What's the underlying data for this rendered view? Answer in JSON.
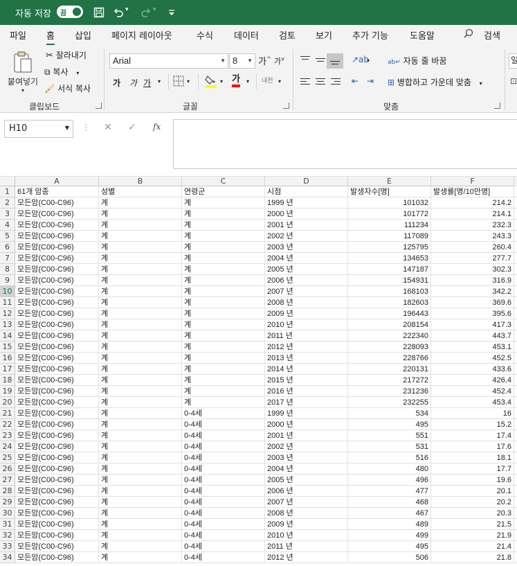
{
  "titlebar": {
    "autosave_label": "자동 저장",
    "autosave_toggle": "끔",
    "colors": {
      "bg": "#217346"
    }
  },
  "tabs": [
    "파일",
    "홈",
    "삽입",
    "페이지 레이아웃",
    "수식",
    "데이터",
    "검토",
    "보기",
    "추가 기능",
    "도움말"
  ],
  "search_label": "검색",
  "ribbon": {
    "clipboard": {
      "paste": "붙여넣기",
      "cut": "잘라내기",
      "copy": "복사",
      "format_painter": "서식 복사",
      "group": "클립보드"
    },
    "font": {
      "name": "Arial",
      "size": "8",
      "grow": "가",
      "shrink": "가",
      "bold": "가",
      "italic": "가",
      "underline": "가",
      "font_color": "가",
      "phonetic": "내천",
      "group": "글꼴"
    },
    "alignment": {
      "wrap_text": "자동 줄 바꿈",
      "merge_center": "병합하고 가운데 맞춤",
      "group": "맞춤"
    },
    "partial_label": "일"
  },
  "formula_bar": {
    "name_box": "H10",
    "cancel": "✕",
    "enter": "✓",
    "fx": "fx",
    "value": ""
  },
  "sheet": {
    "columns": [
      "A",
      "B",
      "C",
      "D",
      "E",
      "F"
    ],
    "header": [
      "61개 암종",
      "성별",
      "연령군",
      "시점",
      "발생자수[명]",
      "발생률[명/10만명]"
    ],
    "selected_row": 10,
    "rows": [
      [
        "모든암(C00-C96)",
        "계",
        "계",
        "1999 년",
        "101032",
        "214.2"
      ],
      [
        "모든암(C00-C96)",
        "계",
        "계",
        "2000 년",
        "101772",
        "214.1"
      ],
      [
        "모든암(C00-C96)",
        "계",
        "계",
        "2001 년",
        "111234",
        "232.3"
      ],
      [
        "모든암(C00-C96)",
        "계",
        "계",
        "2002 년",
        "117089",
        "243.3"
      ],
      [
        "모든암(C00-C96)",
        "계",
        "계",
        "2003 년",
        "125795",
        "260.4"
      ],
      [
        "모든암(C00-C96)",
        "계",
        "계",
        "2004 년",
        "134653",
        "277.7"
      ],
      [
        "모든암(C00-C96)",
        "계",
        "계",
        "2005 년",
        "147187",
        "302.3"
      ],
      [
        "모든암(C00-C96)",
        "계",
        "계",
        "2006 년",
        "154931",
        "316.9"
      ],
      [
        "모든암(C00-C96)",
        "계",
        "계",
        "2007 년",
        "168103",
        "342.2"
      ],
      [
        "모든암(C00-C96)",
        "계",
        "계",
        "2008 년",
        "182603",
        "369.6"
      ],
      [
        "모든암(C00-C96)",
        "계",
        "계",
        "2009 년",
        "196443",
        "395.6"
      ],
      [
        "모든암(C00-C96)",
        "계",
        "계",
        "2010 년",
        "208154",
        "417.3"
      ],
      [
        "모든암(C00-C96)",
        "계",
        "계",
        "2011 년",
        "222340",
        "443.7"
      ],
      [
        "모든암(C00-C96)",
        "계",
        "계",
        "2012 년",
        "228093",
        "453.1"
      ],
      [
        "모든암(C00-C96)",
        "계",
        "계",
        "2013 년",
        "228766",
        "452.5"
      ],
      [
        "모든암(C00-C96)",
        "계",
        "계",
        "2014 년",
        "220131",
        "433.6"
      ],
      [
        "모든암(C00-C96)",
        "계",
        "계",
        "2015 년",
        "217272",
        "426.4"
      ],
      [
        "모든암(C00-C96)",
        "계",
        "계",
        "2016 년",
        "231236",
        "452.4"
      ],
      [
        "모든암(C00-C96)",
        "계",
        "계",
        "2017 년",
        "232255",
        "453.4"
      ],
      [
        "모든암(C00-C96)",
        "계",
        "0-4세",
        "1999 년",
        "534",
        "16"
      ],
      [
        "모든암(C00-C96)",
        "계",
        "0-4세",
        "2000 년",
        "495",
        "15.2"
      ],
      [
        "모든암(C00-C96)",
        "계",
        "0-4세",
        "2001 년",
        "551",
        "17.4"
      ],
      [
        "모든암(C00-C96)",
        "계",
        "0-4세",
        "2002 년",
        "531",
        "17.6"
      ],
      [
        "모든암(C00-C96)",
        "계",
        "0-4세",
        "2003 년",
        "516",
        "18.1"
      ],
      [
        "모든암(C00-C96)",
        "계",
        "0-4세",
        "2004 년",
        "480",
        "17.7"
      ],
      [
        "모든암(C00-C96)",
        "계",
        "0-4세",
        "2005 년",
        "496",
        "19.6"
      ],
      [
        "모든암(C00-C96)",
        "계",
        "0-4세",
        "2006 년",
        "477",
        "20.1"
      ],
      [
        "모든암(C00-C96)",
        "계",
        "0-4세",
        "2007 년",
        "468",
        "20.2"
      ],
      [
        "모든암(C00-C96)",
        "계",
        "0-4세",
        "2008 년",
        "467",
        "20.3"
      ],
      [
        "모든암(C00-C96)",
        "계",
        "0-4세",
        "2009 년",
        "489",
        "21.5"
      ],
      [
        "모든암(C00-C96)",
        "계",
        "0-4세",
        "2010 년",
        "499",
        "21.9"
      ],
      [
        "모든암(C00-C96)",
        "계",
        "0-4세",
        "2011 년",
        "495",
        "21.4"
      ],
      [
        "모든암(C00-C96)",
        "계",
        "0-4세",
        "2012 년",
        "506",
        "21.8"
      ]
    ]
  }
}
